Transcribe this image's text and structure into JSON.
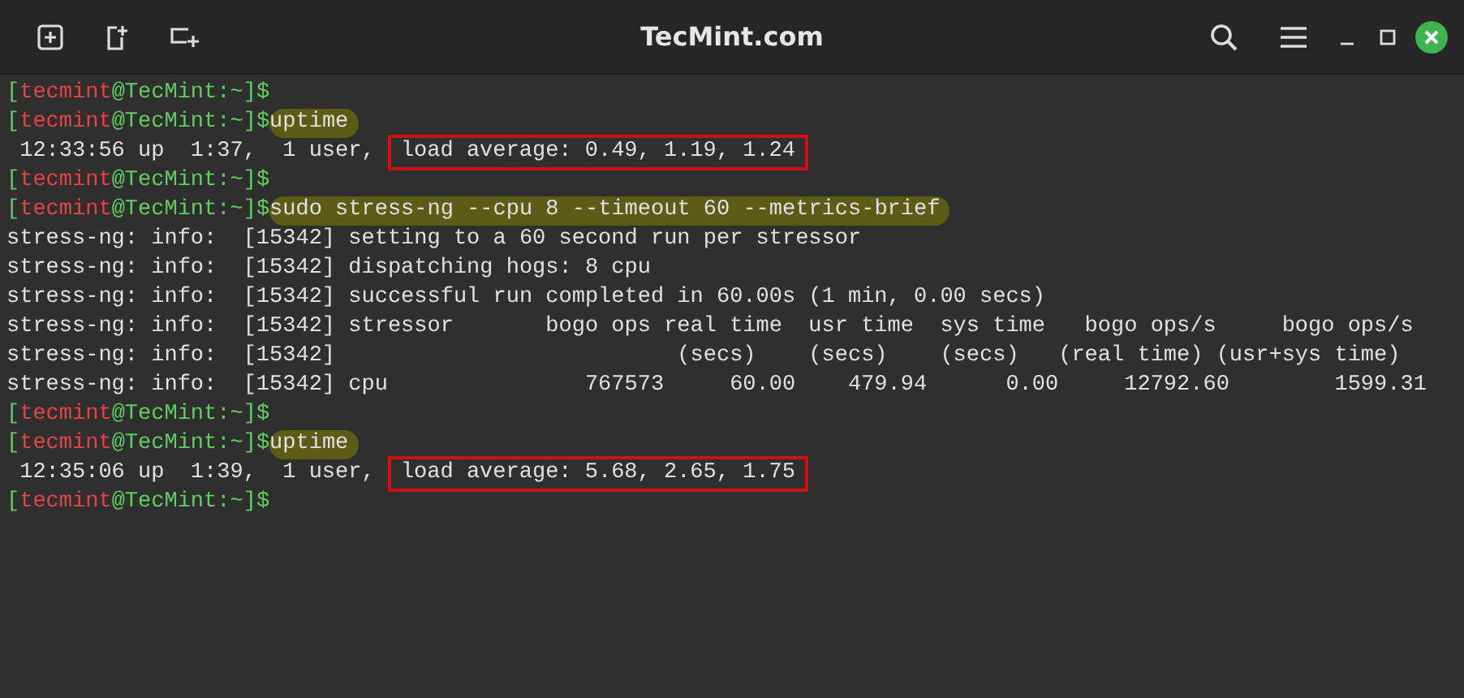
{
  "window": {
    "title": "TecMint.com"
  },
  "terminal": {
    "lines": [
      {
        "kind": "prompt",
        "prompt": [
          {
            "kind": "host",
            "text": "["
          },
          {
            "kind": "user",
            "text": "tecmint"
          },
          {
            "kind": "host",
            "text": "@TecMint:~]$"
          }
        ]
      },
      {
        "kind": "prompt",
        "prompt": [
          {
            "kind": "host",
            "text": "["
          },
          {
            "kind": "user",
            "text": "tecmint"
          },
          {
            "kind": "host",
            "text": "@TecMint:~]$"
          }
        ],
        "command": "uptime",
        "highlighted": true
      },
      {
        "kind": "output",
        "text": " 12:33:56 up  1:37,  1 user, ",
        "boxed": "load average: 0.49, 1.19, 1.24"
      },
      {
        "kind": "prompt",
        "prompt": [
          {
            "kind": "host",
            "text": "["
          },
          {
            "kind": "user",
            "text": "tecmint"
          },
          {
            "kind": "host",
            "text": "@TecMint:~]$"
          }
        ]
      },
      {
        "kind": "prompt",
        "prompt": [
          {
            "kind": "host",
            "text": "["
          },
          {
            "kind": "user",
            "text": "tecmint"
          },
          {
            "kind": "host",
            "text": "@TecMint:~]$"
          }
        ],
        "command": "sudo stress-ng --cpu 8 --timeout 60 --metrics-brief",
        "highlighted": true
      },
      {
        "kind": "output",
        "text": "stress-ng: info:  [15342] setting to a 60 second run per stressor"
      },
      {
        "kind": "output",
        "text": "stress-ng: info:  [15342] dispatching hogs: 8 cpu"
      },
      {
        "kind": "output",
        "text": "stress-ng: info:  [15342] successful run completed in 60.00s (1 min, 0.00 secs)"
      },
      {
        "kind": "output",
        "text": "stress-ng: info:  [15342] stressor       bogo ops real time  usr time  sys time   bogo ops/s     bogo ops/s"
      },
      {
        "kind": "output",
        "text": "stress-ng: info:  [15342]                          (secs)    (secs)    (secs)   (real time) (usr+sys time)"
      },
      {
        "kind": "output",
        "text": "stress-ng: info:  [15342] cpu               767573     60.00    479.94      0.00     12792.60        1599.31"
      },
      {
        "kind": "prompt",
        "prompt": [
          {
            "kind": "host",
            "text": "["
          },
          {
            "kind": "user",
            "text": "tecmint"
          },
          {
            "kind": "host",
            "text": "@TecMint:~]$"
          }
        ]
      },
      {
        "kind": "prompt",
        "prompt": [
          {
            "kind": "host",
            "text": "["
          },
          {
            "kind": "user",
            "text": "tecmint"
          },
          {
            "kind": "host",
            "text": "@TecMint:~]$"
          }
        ],
        "command": "uptime",
        "highlighted": true
      },
      {
        "kind": "output",
        "text": " 12:35:06 up  1:39,  1 user, ",
        "boxed": "load average: 5.68, 2.65, 1.75"
      },
      {
        "kind": "prompt",
        "prompt": [
          {
            "kind": "host",
            "text": "["
          },
          {
            "kind": "user",
            "text": "tecmint"
          },
          {
            "kind": "host",
            "text": "@TecMint:~]$"
          }
        ]
      }
    ]
  }
}
